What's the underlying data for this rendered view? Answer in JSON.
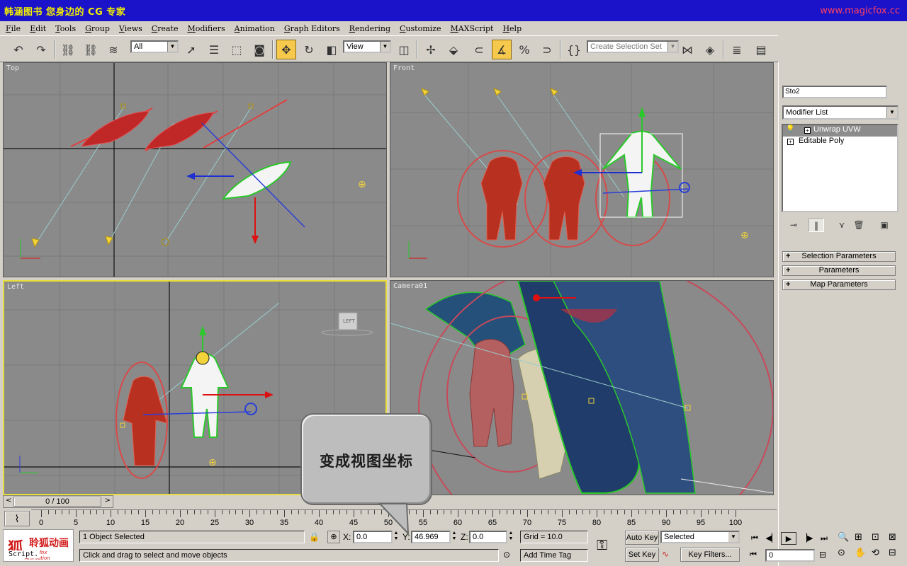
{
  "titlebar": {
    "title": "韩涵图书 您身边的 CG 专家",
    "website": "www.magicfox.cc"
  },
  "menu": [
    "File",
    "Edit",
    "Tools",
    "Group",
    "Views",
    "Create",
    "Modifiers",
    "Animation",
    "Graph Editors",
    "Rendering",
    "Customize",
    "MAXScript",
    "Help"
  ],
  "toolbar": {
    "filter_value": "All",
    "coord_value": "View",
    "selection_set_placeholder": "Create Selection Set"
  },
  "viewports": {
    "top": "Top",
    "front": "Front",
    "left": "Left",
    "camera": "Camera01"
  },
  "viewcube_label": "LEFT",
  "command_panel": {
    "object_name": "Sto2",
    "modifier_list": "Modifier List",
    "stack": [
      {
        "label": "Unwrap UVW",
        "selected": true
      },
      {
        "label": "Editable Poly",
        "selected": false
      }
    ],
    "rollouts": [
      "Selection Parameters",
      "Parameters",
      "Map Parameters"
    ]
  },
  "timeline": {
    "frame_display": "0 / 100",
    "ticks": [
      0,
      5,
      10,
      15,
      20,
      25,
      30,
      35,
      40,
      45,
      50,
      55,
      60,
      65,
      70,
      75,
      80,
      85,
      90,
      95,
      100
    ]
  },
  "status": {
    "selected": "1 Object Selected",
    "prompt": "Click and drag to select and move objects",
    "x_label": "X:",
    "x_value": "0.0",
    "y_label": "Y:",
    "y_value": "46.969",
    "z_label": "Z:",
    "z_value": "0.0",
    "grid": "Grid = 10.0",
    "add_time_tag": "Add Time Tag",
    "auto_key": "Auto Key",
    "set_key": "Set Key",
    "key_mode": "Selected",
    "key_filters": "Key Filters...",
    "current_frame": "0",
    "script_label": "Script."
  },
  "logo": {
    "mark": "狐",
    "name": "聆狐动画",
    "tagline": "Magicfox Animation"
  },
  "callout": {
    "text": "变成视图坐标"
  },
  "colors": {
    "title_bg": "#1a13c9",
    "title_fg": "#f4f000",
    "viewport_bg": "#8a8a8a",
    "active_border": "#e8dd3a"
  }
}
